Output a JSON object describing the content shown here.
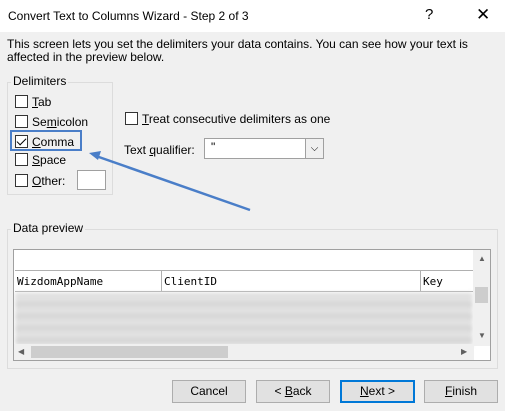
{
  "window": {
    "title": "Convert Text to Columns Wizard - Step 2 of 3",
    "help_label": "?",
    "close_label": "✕"
  },
  "description": "This screen lets you set the delimiters your data contains.  You can see how your text is affected in the preview below.",
  "delimiters": {
    "label": "Delimiters",
    "tab": {
      "label": "Tab",
      "checked": false
    },
    "semicolon": {
      "label": "Semicolon",
      "checked": false
    },
    "comma": {
      "label": "Comma",
      "checked": true
    },
    "space": {
      "label": "Space",
      "checked": false
    },
    "other": {
      "label": "Other:",
      "checked": false,
      "value": ""
    }
  },
  "options": {
    "consecutive_label": "Treat consecutive delimiters as one",
    "consecutive_checked": false,
    "qualifier_label": "Text qualifier:",
    "qualifier_value": "\""
  },
  "preview": {
    "label": "Data preview",
    "columns": [
      "WizdomAppName",
      "ClientID",
      "Key"
    ]
  },
  "buttons": {
    "cancel": "Cancel",
    "back": "< Back",
    "next": "Next >",
    "finish": "Finish"
  },
  "colors": {
    "highlight": "#4a7ec8",
    "primary_border": "#0078d7"
  }
}
